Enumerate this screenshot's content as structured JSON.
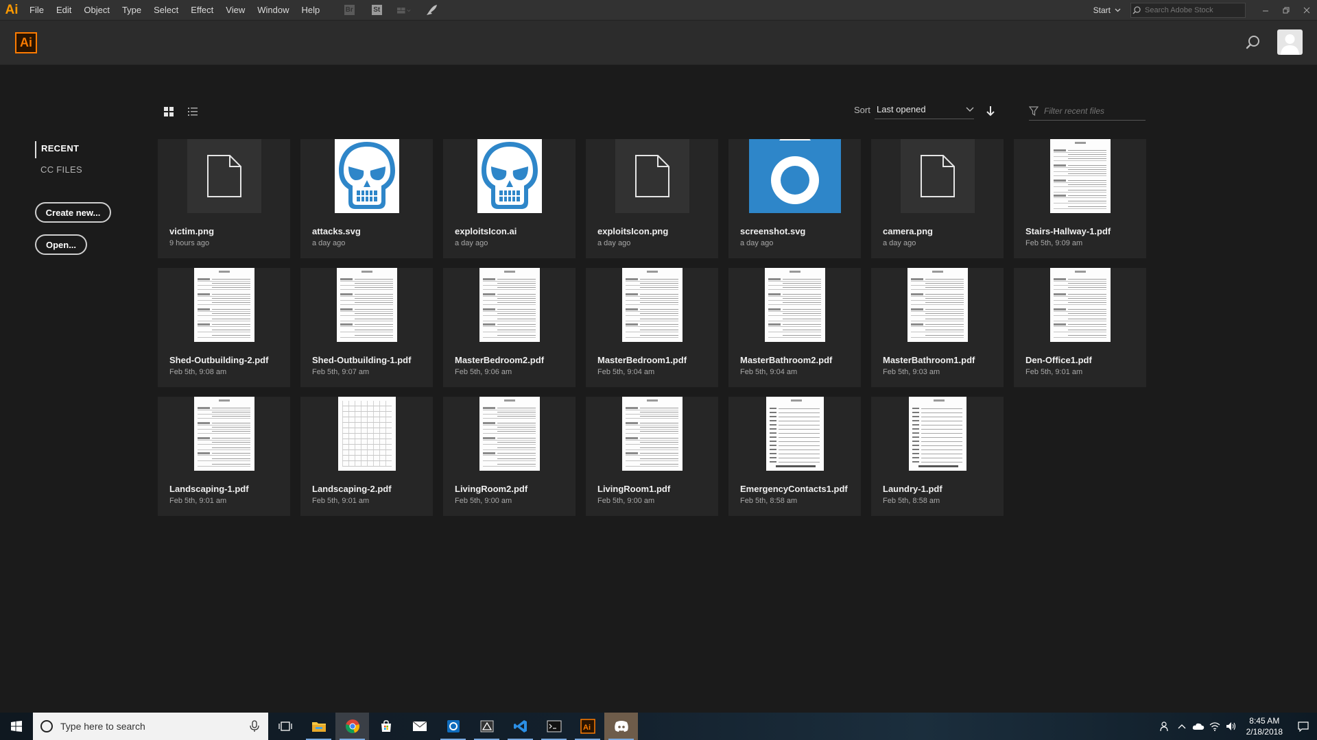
{
  "menubar": {
    "logo": "Ai",
    "items": [
      "File",
      "Edit",
      "Object",
      "Type",
      "Select",
      "Effect",
      "View",
      "Window",
      "Help"
    ],
    "toolbar_icons": [
      "bridge-icon",
      "stock-icon",
      "arrange-documents-icon",
      "gpu-rocket-icon"
    ],
    "workspace": "Start",
    "stock_search_placeholder": "Search Adobe Stock"
  },
  "header": {
    "badge": "Ai"
  },
  "sidebar": {
    "recent": "RECENT",
    "cc_files": "CC FILES",
    "create_new": "Create new...",
    "open": "Open..."
  },
  "toolbar": {
    "sort_label": "Sort",
    "sort_value": "Last opened",
    "filter_placeholder": "Filter recent files"
  },
  "files": [
    {
      "name": "victim.png",
      "time": "9 hours ago",
      "thumb": "generic"
    },
    {
      "name": "attacks.svg",
      "time": "a day ago",
      "thumb": "skull"
    },
    {
      "name": "exploitsIcon.ai",
      "time": "a day ago",
      "thumb": "skull"
    },
    {
      "name": "exploitsIcon.png",
      "time": "a day ago",
      "thumb": "generic"
    },
    {
      "name": "screenshot.svg",
      "time": "a day ago",
      "thumb": "camera"
    },
    {
      "name": "camera.png",
      "time": "a day ago",
      "thumb": "generic"
    },
    {
      "name": "Stairs-Hallway-1.pdf",
      "time": "Feb 5th, 9:09 am",
      "thumb": "paper"
    },
    {
      "name": "Shed-Outbuilding-2.pdf",
      "time": "Feb 5th, 9:08 am",
      "thumb": "paper"
    },
    {
      "name": "Shed-Outbuilding-1.pdf",
      "time": "Feb 5th, 9:07 am",
      "thumb": "paper"
    },
    {
      "name": "MasterBedroom2.pdf",
      "time": "Feb 5th, 9:06 am",
      "thumb": "paper"
    },
    {
      "name": "MasterBedroom1.pdf",
      "time": "Feb 5th, 9:04 am",
      "thumb": "paper"
    },
    {
      "name": "MasterBathroom2.pdf",
      "time": "Feb 5th, 9:04 am",
      "thumb": "paper"
    },
    {
      "name": "MasterBathroom1.pdf",
      "time": "Feb 5th, 9:03 am",
      "thumb": "paper"
    },
    {
      "name": "Den-Office1.pdf",
      "time": "Feb 5th, 9:01 am",
      "thumb": "paper"
    },
    {
      "name": "Landscaping-1.pdf",
      "time": "Feb 5th, 9:01 am",
      "thumb": "paper"
    },
    {
      "name": "Landscaping-2.pdf",
      "time": "Feb 5th, 9:01 am",
      "thumb": "gridpaper"
    },
    {
      "name": "LivingRoom2.pdf",
      "time": "Feb 5th, 9:00 am",
      "thumb": "paper"
    },
    {
      "name": "LivingRoom1.pdf",
      "time": "Feb 5th, 9:00 am",
      "thumb": "paper"
    },
    {
      "name": "EmergencyContacts1.pdf",
      "time": "Feb 5th, 8:58 am",
      "thumb": "formpaper"
    },
    {
      "name": "Laundry-1.pdf",
      "time": "Feb 5th, 8:58 am",
      "thumb": "formpaper"
    }
  ],
  "taskbar": {
    "search_placeholder": "Type here to search",
    "apps": [
      "task-view-icon",
      "file-explorer-icon",
      "chrome-icon",
      "store-icon",
      "mail-icon",
      "outlook-icon",
      "unity-icon",
      "vscode-icon",
      "terminal-icon",
      "illustrator-icon",
      "discord-icon"
    ],
    "time": "8:45 AM",
    "date": "2/18/2018"
  },
  "colors": {
    "accent": "#ff7c00",
    "background": "#1b1b1b",
    "card": "#262626",
    "camera_blue": "#2e86c9"
  }
}
